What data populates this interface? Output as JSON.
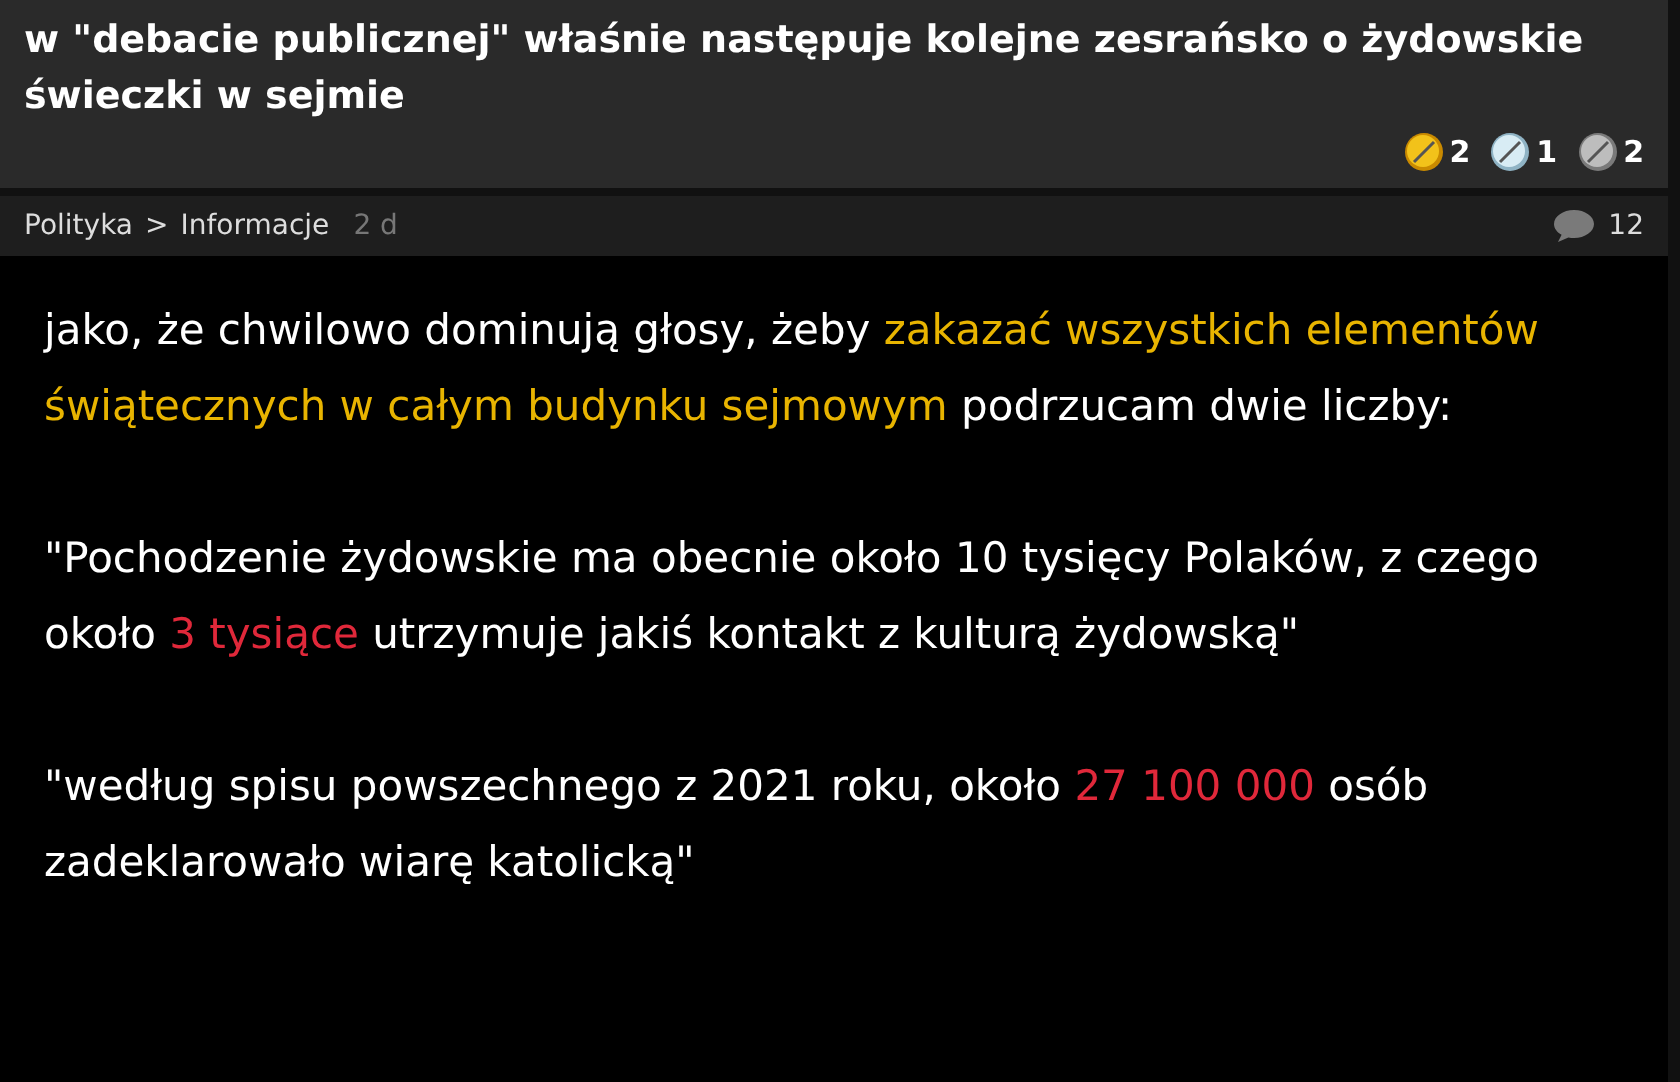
{
  "post": {
    "title": "w \"debacie publicznej\" właśnie następuje kolejne zesrańsko o żydowskie świeczki w sejmie",
    "awards": [
      {
        "kind": "gold",
        "count": "2"
      },
      {
        "kind": "silver",
        "count": "1"
      },
      {
        "kind": "steel",
        "count": "2"
      }
    ],
    "category": "Polityka",
    "subcategory": "Informacje",
    "separator": ">",
    "age": "2 d",
    "comments": "12",
    "paragraphs": [
      [
        {
          "kind": "plain",
          "text": "jako, że chwilowo dominują głosy, żeby "
        },
        {
          "kind": "link",
          "text": "zakazać wszystkich elementów świątecznych w całym budynku sejmowym"
        },
        {
          "kind": "plain",
          "text": " podrzucam dwie liczby:"
        }
      ],
      [
        {
          "kind": "plain",
          "text": "\"Pochodzenie żydowskie ma obecnie około 10 tysięcy Polaków, z czego około "
        },
        {
          "kind": "emphasis",
          "text": "3 tysiące"
        },
        {
          "kind": "plain",
          "text": " utrzymuje jakiś kontakt z kulturą żydowską\""
        }
      ],
      [
        {
          "kind": "plain",
          "text": "\"według spisu powszechnego z 2021 roku, około "
        },
        {
          "kind": "emphasis",
          "text": "27 100 000"
        },
        {
          "kind": "plain",
          "text": " osób zadeklarowało wiarę katolicką\""
        }
      ]
    ]
  }
}
